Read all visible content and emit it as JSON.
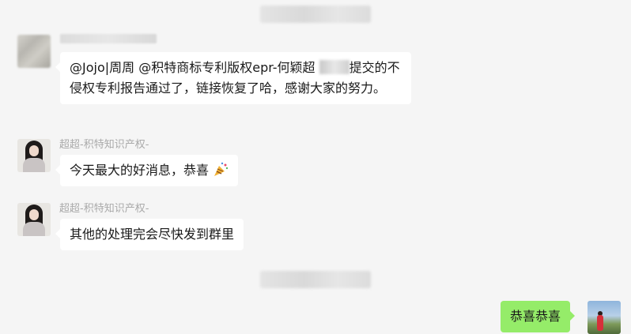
{
  "messages": [
    {
      "text_before_blur": "@Jojo|周周 @积特商标专利版权epr-何颖超 ",
      "text_after_blur": "提交的不侵权专利报告通过了，链接恢复了哈，感谢大家的努力。"
    },
    {
      "sender": "超超-积特知识产权-",
      "text": "今天最大的好消息，恭喜",
      "emoji_icon": "party-popper-icon"
    },
    {
      "sender": "超超-积特知识产权-",
      "text": "其他的处理完会尽快发到群里"
    },
    {
      "text": "恭喜恭喜"
    }
  ],
  "colors": {
    "background": "#f5f5f5",
    "bubble_incoming": "#ffffff",
    "bubble_outgoing": "#95ec69",
    "sender_name": "#a9a9a9"
  }
}
